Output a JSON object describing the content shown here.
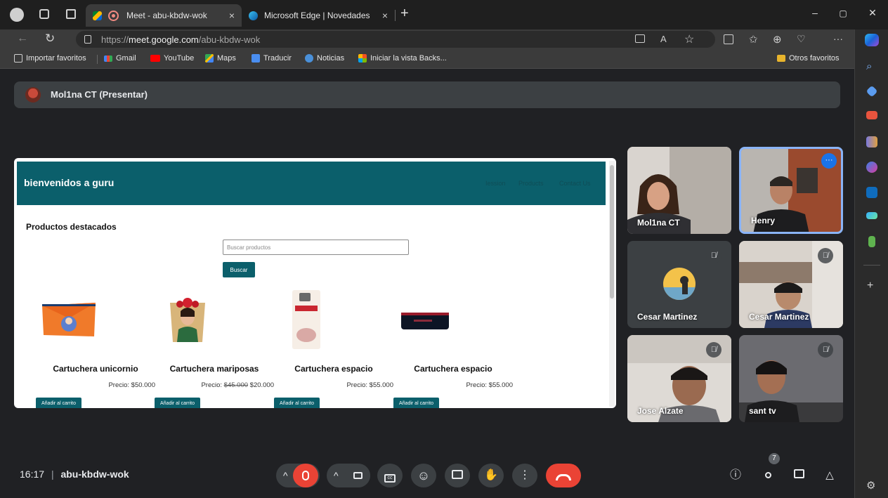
{
  "browser": {
    "tabs": [
      {
        "label": "Meet - abu-kbdw-wok",
        "close": "×"
      },
      {
        "label": "Microsoft Edge | Novedades",
        "close": "×"
      }
    ],
    "new_tab": "+",
    "window_controls": {
      "minimize": "–",
      "restore": "▢",
      "close": "✕"
    },
    "nav": {
      "back": "←",
      "reload": "↻"
    },
    "url_prefix": "https://",
    "url_host": "meet.google.com",
    "url_path": "/abu-kbdw-wok",
    "toolbar_more": "···",
    "bookmarks": [
      {
        "label": "Importar favoritos",
        "icon": "import-icon"
      },
      {
        "label": "Gmail",
        "icon": "gmail-icon"
      },
      {
        "label": "YouTube",
        "icon": "youtube-icon"
      },
      {
        "label": "Maps",
        "icon": "maps-icon"
      },
      {
        "label": "Traducir",
        "icon": "translate-icon"
      },
      {
        "label": "Noticias",
        "icon": "news-icon"
      },
      {
        "label": "Iniciar la vista Backs...",
        "icon": "windows-icon"
      }
    ],
    "other_favorites": "Otros favoritos"
  },
  "meet": {
    "presenting_banner": "Mol1na CT (Presentar)",
    "meeting_time": "16:17",
    "separator": "|",
    "meeting_code": "abu-kbdw-wok",
    "participant_count": "7",
    "participants": [
      {
        "name": "Mol1na CT",
        "muted": false
      },
      {
        "name": "Henry",
        "muted": false
      },
      {
        "name": "Cesar Martinez",
        "muted": true
      },
      {
        "name": "Cesar Martinez",
        "muted": true
      },
      {
        "name": "Jose Alzate",
        "muted": true
      },
      {
        "name": "sant tv",
        "muted": true
      }
    ],
    "tile_menu": "···",
    "muted_icon": "🎙̸"
  },
  "shared_site": {
    "title": "bienvenidos a guru",
    "nav": [
      "Iession",
      "Products",
      "Contact Us"
    ],
    "section_title": "Productos destacados",
    "search_placeholder": "Buscar productos",
    "search_button": "Buscar",
    "products": [
      {
        "name": "Cartuchera unicornio",
        "price": "Precio: $50.000",
        "old_price": "",
        "button": "Añadir al carrito"
      },
      {
        "name": "Cartuchera mariposas",
        "price": "$20.000",
        "price_prefix": "Precio: ",
        "old_price": "$45.000",
        "button": "Añadir al carrito"
      },
      {
        "name": "Cartuchera espacio",
        "price": "Precio: $55.000",
        "old_price": "",
        "button": "Añadir al carrito"
      },
      {
        "name": "Cartuchera espacio",
        "price": "Precio: $55.000",
        "old_price": "",
        "button": "Añadir al carrito"
      }
    ],
    "brand_color": "#0b5f6b"
  }
}
